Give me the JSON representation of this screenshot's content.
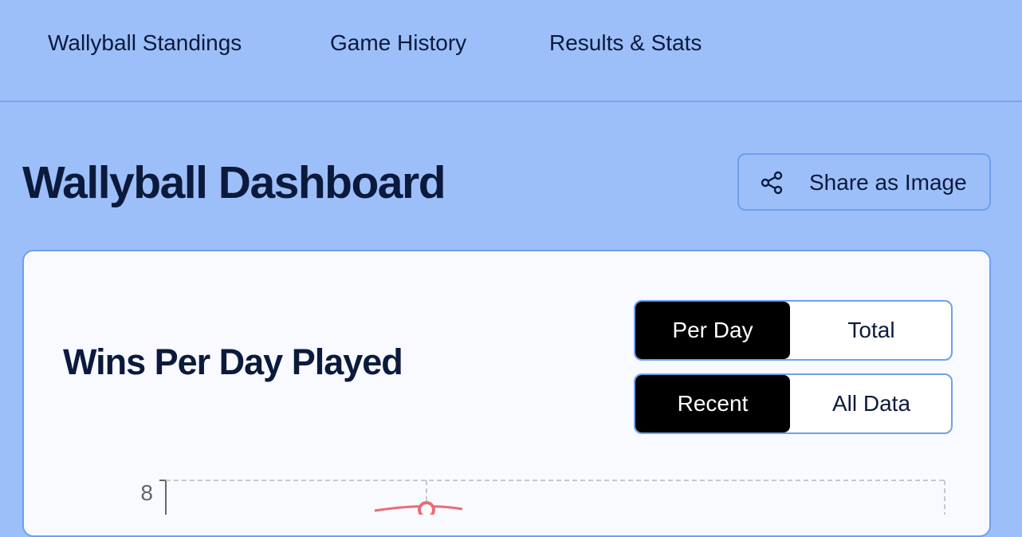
{
  "nav": {
    "items": [
      {
        "label": "Wallyball Standings"
      },
      {
        "label": "Game History"
      },
      {
        "label": "Results & Stats"
      }
    ]
  },
  "page": {
    "title": "Wallyball Dashboard",
    "share_label": "Share as Image",
    "share_icon": "share-icon"
  },
  "card": {
    "title": "Wins Per Day Played",
    "mode_toggle": {
      "options": [
        "Per Day",
        "Total"
      ],
      "selected": "Per Day"
    },
    "range_toggle": {
      "options": [
        "Recent",
        "All Data"
      ],
      "selected": "Recent"
    }
  },
  "colors": {
    "background": "#9dbff9",
    "card": "#f8faff",
    "accent_border": "#6f9ff0",
    "series_line": "#ea6d72"
  },
  "chart_data": {
    "type": "line",
    "y_ticks": [
      "8"
    ],
    "grid": true
  }
}
